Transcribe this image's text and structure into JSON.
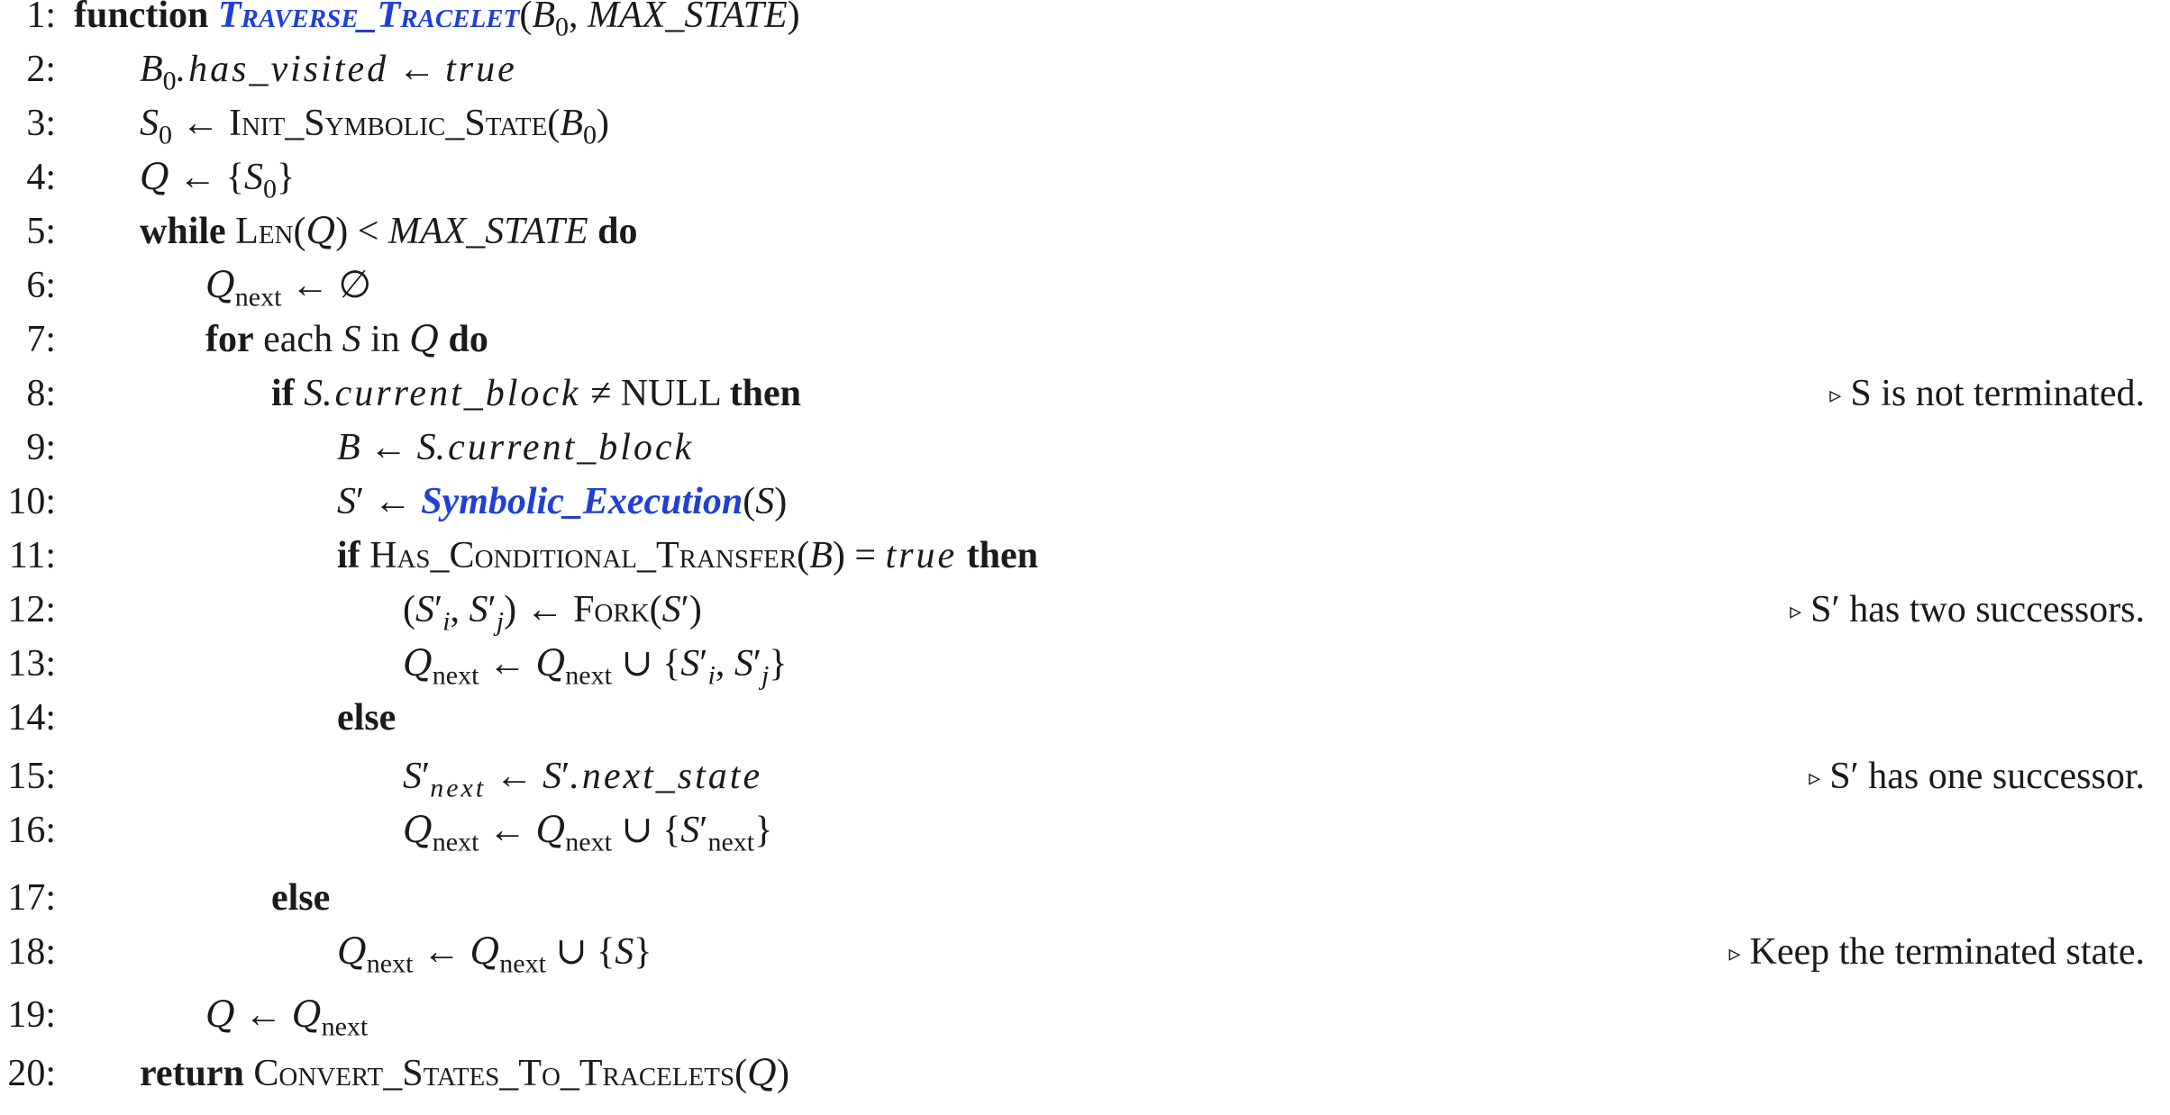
{
  "lines": [
    {
      "num": "1:"
    },
    {
      "num": "2:"
    },
    {
      "num": "3:"
    },
    {
      "num": "4:"
    },
    {
      "num": "5:"
    },
    {
      "num": "6:"
    },
    {
      "num": "7:"
    },
    {
      "num": "8:",
      "comment": "S is not terminated."
    },
    {
      "num": "9:"
    },
    {
      "num": "10:"
    },
    {
      "num": "11:"
    },
    {
      "num": "12:",
      "comment": "S′ has two successors."
    },
    {
      "num": "13:"
    },
    {
      "num": "14:"
    },
    {
      "num": "15:",
      "comment": "S′ has one successor."
    },
    {
      "num": "16:"
    },
    {
      "num": "17:"
    },
    {
      "num": "18:",
      "comment": "Keep the terminated state."
    },
    {
      "num": "19:"
    },
    {
      "num": "20:"
    }
  ],
  "kw": {
    "function": "function",
    "while": "while",
    "do": "do",
    "for_each": "for",
    "each": "each",
    "in": "in",
    "if": "if",
    "then": "then",
    "else": "else",
    "return": "return"
  },
  "names": {
    "traverse_tracelet": "Traverse_Tracelet",
    "init_symbolic_state": "Init_Symbolic_State",
    "len": "Len",
    "symbolic_execution": "Symbolic_Execution",
    "has_conditional_transfer": "Has_Conditional_Transfer",
    "fork": "Fork",
    "convert_states_to_tracelets": "Convert_States_To_Tracelets"
  },
  "vars": {
    "B": "B",
    "B0_sub": "0",
    "S": "S",
    "S0_sub": "0",
    "Q": "Q",
    "max_state": "MAX_STATE",
    "has_visited": ".has_visited",
    "true": "true",
    "null": "NULL",
    "current_block": ".current_block",
    "next_state": ".next_state",
    "next": "next",
    "i": "i",
    "j": "j",
    "prime": "′"
  },
  "symbols": {
    "arrow": "←",
    "lt": "<",
    "empty": "∅",
    "neq": "≠",
    "eq": "=",
    "union": "∪",
    "comment_marker": "▹"
  }
}
